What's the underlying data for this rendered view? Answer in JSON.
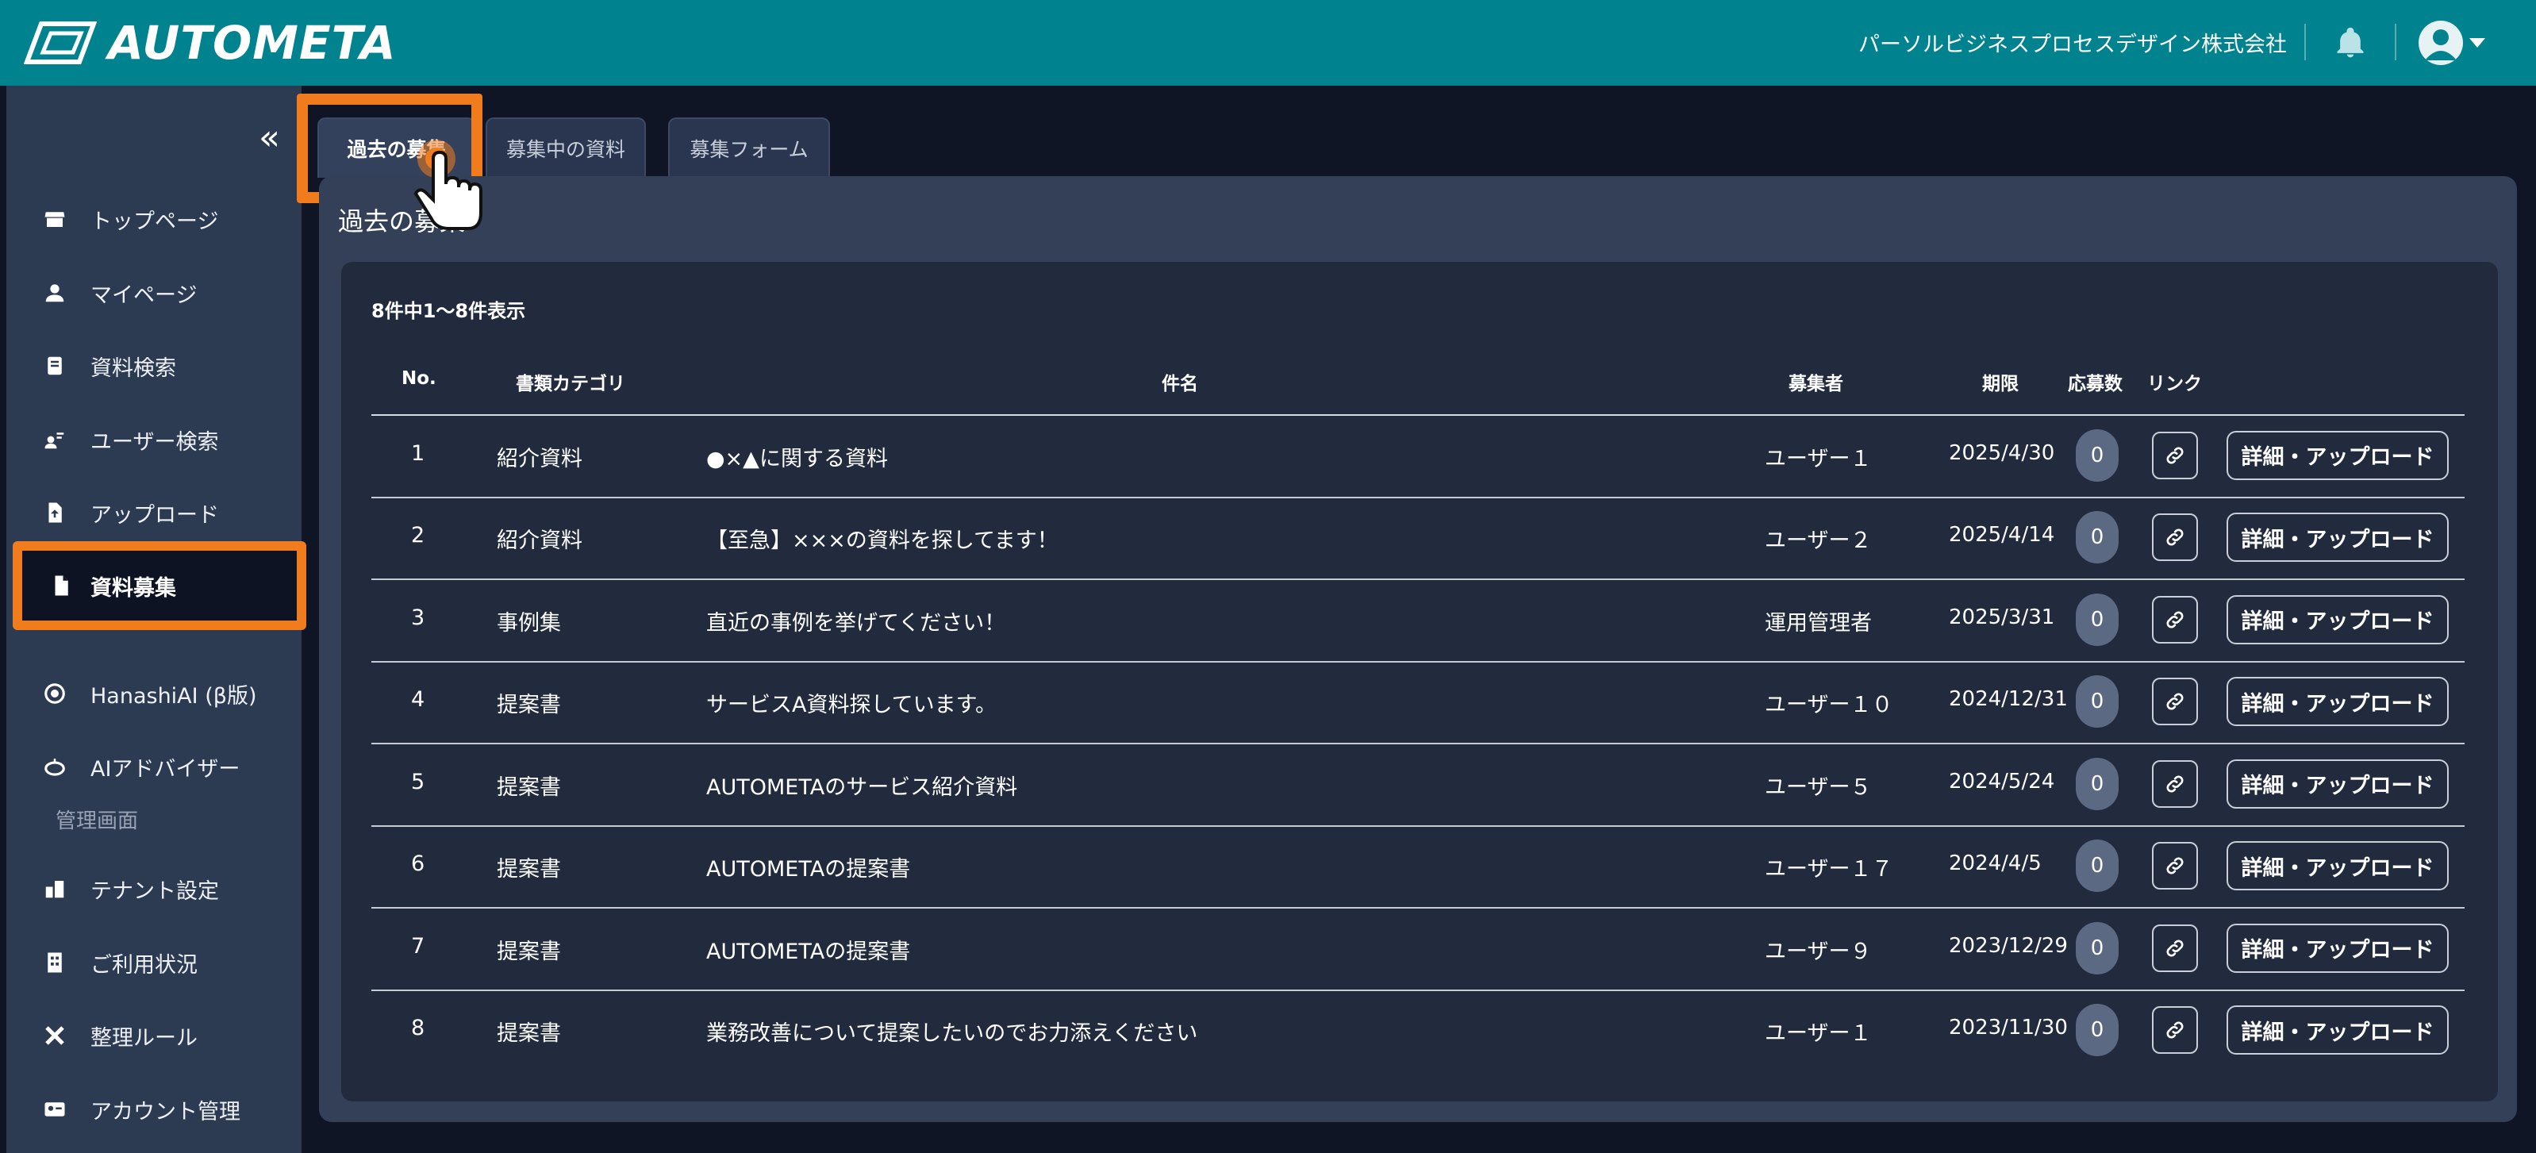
{
  "header": {
    "logo_text": "AUTOMETA",
    "company": "パーソルビジネスプロセスデザイン株式会社",
    "icons": [
      "bell-icon",
      "user-avatar-icon",
      "caret-down-icon"
    ]
  },
  "sidebar": {
    "collapse_icon": "«",
    "items": [
      {
        "label": "トップページ",
        "icon": "store-icon"
      },
      {
        "label": "マイページ",
        "icon": "person-icon"
      },
      {
        "label": "資料検索",
        "icon": "document-search-icon"
      },
      {
        "label": "ユーザー検索",
        "icon": "user-search-icon"
      },
      {
        "label": "アップロード",
        "icon": "file-upload-icon"
      },
      {
        "label": "資料募集",
        "icon": "file-icon"
      },
      {
        "label": "HanashiAI (β版)",
        "icon": "chat-bot-icon"
      },
      {
        "label": "AIアドバイザー",
        "icon": "robot-icon"
      }
    ],
    "admin_section": "管理画面",
    "admin_items": [
      {
        "label": "テナント設定",
        "icon": "building-icon"
      },
      {
        "label": "ご利用状況",
        "icon": "office-icon"
      },
      {
        "label": "整理ルール",
        "icon": "tools-icon"
      },
      {
        "label": "アカウント管理",
        "icon": "id-card-icon"
      }
    ]
  },
  "tabs": [
    {
      "label": "過去の募集"
    },
    {
      "label": "募集中の資料"
    },
    {
      "label": "募集フォーム"
    }
  ],
  "panel": {
    "title": "過去の募集",
    "count_text": "8件中1〜8件表示"
  },
  "table": {
    "headers": [
      "No.",
      "書類カテゴリ",
      "件名",
      "募集者",
      "期限",
      "応募数",
      "リンク"
    ],
    "action_label": "詳細・アップロード",
    "rows": [
      {
        "no": "1",
        "category": "紹介資料",
        "subject": "●×▲に関する資料",
        "requester": "ユーザー１",
        "deadline": "2025/4/30",
        "responses": "0"
      },
      {
        "no": "2",
        "category": "紹介資料",
        "subject": "【至急】×××の資料を探してます！",
        "requester": "ユーザー２",
        "deadline": "2025/4/14",
        "responses": "0"
      },
      {
        "no": "3",
        "category": "事例集",
        "subject": "直近の事例を挙げてください！",
        "requester": "運用管理者",
        "deadline": "2025/3/31",
        "responses": "0"
      },
      {
        "no": "4",
        "category": "提案書",
        "subject": "サービスA資料探しています。",
        "requester": "ユーザー１０",
        "deadline": "2024/12/31",
        "responses": "0"
      },
      {
        "no": "5",
        "category": "提案書",
        "subject": "AUTOMETAのサービス紹介資料",
        "requester": "ユーザー５",
        "deadline": "2024/5/24",
        "responses": "0"
      },
      {
        "no": "6",
        "category": "提案書",
        "subject": "AUTOMETAの提案書",
        "requester": "ユーザー１７",
        "deadline": "2024/4/5",
        "responses": "0"
      },
      {
        "no": "7",
        "category": "提案書",
        "subject": "AUTOMETAの提案書",
        "requester": "ユーザー９",
        "deadline": "2023/12/29",
        "responses": "0"
      },
      {
        "no": "8",
        "category": "提案書",
        "subject": "業務改善について提案したいのでお力添えください",
        "requester": "ユーザー１",
        "deadline": "2023/11/30",
        "responses": "0"
      }
    ]
  },
  "colors": {
    "header_bg": "#00838f",
    "sidebar_bg": "#2c3a52",
    "highlight": "#f07c1e",
    "badge_bg": "#5b6983"
  }
}
